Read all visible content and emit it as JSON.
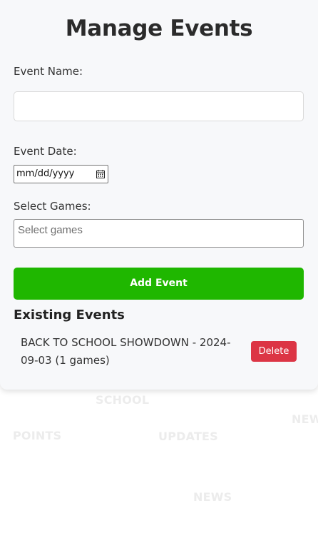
{
  "page": {
    "title": "Manage Events"
  },
  "form": {
    "event_name_label": "Event Name:",
    "event_name_value": "",
    "event_date_label": "Event Date:",
    "event_date_placeholder": "mm/dd/yyyy",
    "select_games_label": "Select Games:",
    "select_games_placeholder": "Select games",
    "add_button_label": "Add Event"
  },
  "existing": {
    "title": "Existing Events",
    "events": [
      {
        "text": "BACK TO SCHOOL SHOWDOWN - 2024-09-03 (1 games)",
        "delete_label": "Delete"
      }
    ]
  },
  "background_words": {
    "school": "SCHOOL",
    "points": "POINTS",
    "updates": "UPDATES",
    "news_right": "NEW",
    "news_center": "NEWS"
  },
  "colors": {
    "accent_green": "#1fb700",
    "danger_red": "#dc3545",
    "card_bg": "#f7f8fa"
  },
  "icons": {
    "date": "calendar-icon"
  }
}
